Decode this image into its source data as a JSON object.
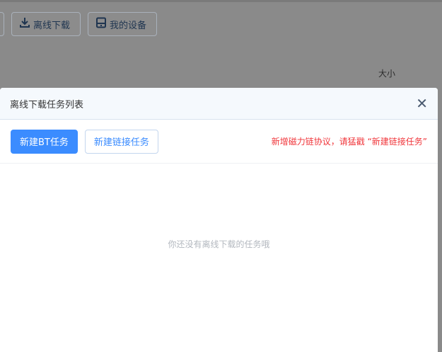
{
  "background": {
    "offline_download": "离线下载",
    "my_devices": "我的设备",
    "size_header": "大小"
  },
  "modal": {
    "title": "离线下载任务列表",
    "new_bt_task": "新建BT任务",
    "new_link_task": "新建链接任务",
    "notice": "新增磁力链协议，请猛戳 “新建链接任务”",
    "empty_text": "你还没有离线下载的任务哦"
  },
  "colors": {
    "primary": "#3b8cff",
    "notice": "#f0353a"
  }
}
